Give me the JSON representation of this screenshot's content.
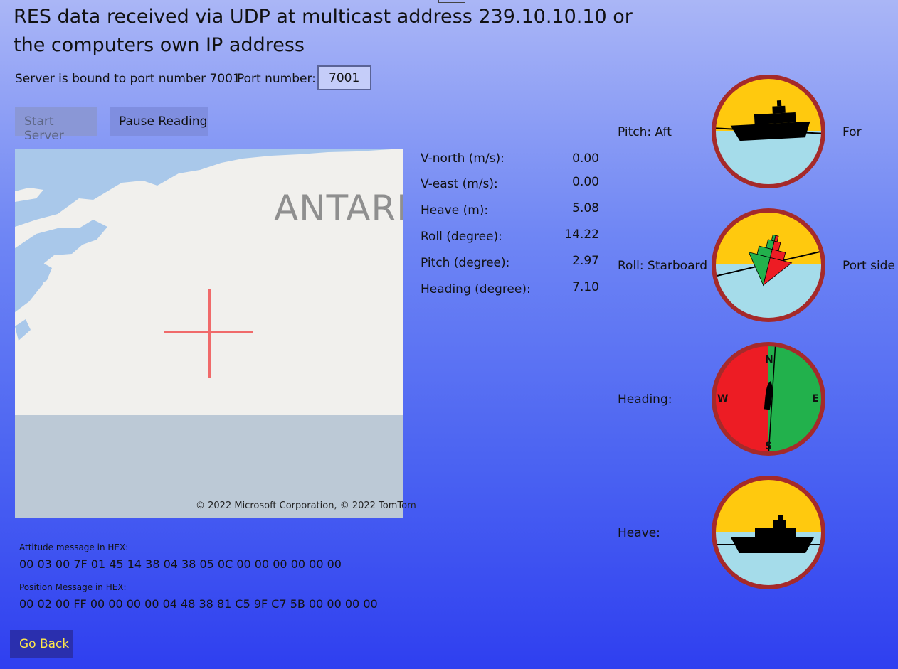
{
  "title_line1": "RES data received via UDP at multicast address 239.10.10.10 or",
  "title_line2": "the computers own IP address",
  "server_status": "Server is bound to port number 7001",
  "port_label": "Port number:",
  "port_value": "7001",
  "buttons": {
    "start": "Start Server",
    "pause": "Pause Reading",
    "go_back": "Go Back"
  },
  "map": {
    "label": "ANTARK",
    "copyright": "© 2022 Microsoft Corporation, © 2022 TomTom"
  },
  "readings": [
    {
      "label": "V-north (m/s):",
      "value": "0.00"
    },
    {
      "label": "V-east (m/s):",
      "value": "0.00"
    },
    {
      "label": "Heave (m):",
      "value": "5.08"
    },
    {
      "label": "Roll (degree):",
      "value": "14.22"
    },
    {
      "label": "Pitch (degree):",
      "value": "2.97"
    },
    {
      "label": "Heading (degree):",
      "value": "7.10"
    }
  ],
  "gauges": {
    "pitch": {
      "label": "Pitch:  Aft",
      "right": "For"
    },
    "roll": {
      "label": "Roll:  Starboard",
      "right": "Port side"
    },
    "heading": {
      "label": "Heading:",
      "n": "N",
      "e": "E",
      "s": "S",
      "w": "W"
    },
    "heave": {
      "label": "Heave:"
    }
  },
  "hex": {
    "attitude_label": "Attitude message in HEX:",
    "attitude_value": "00 03 00 7F 01 45 14 38 04 38 05 0C 00 00 00 00 00 00",
    "position_label": "Position Message in HEX:",
    "position_value": "00 02 00 FF 00 00 00 00 04 48 38 81 C5 9F C7 5B 00 00 00 00"
  },
  "colors": {
    "sky": "#ffc90e",
    "sea": "#a5dcea",
    "rim": "#a52a2a",
    "west": "#ed1c24",
    "east": "#22b14c",
    "crosshair": "#f06a6a"
  }
}
